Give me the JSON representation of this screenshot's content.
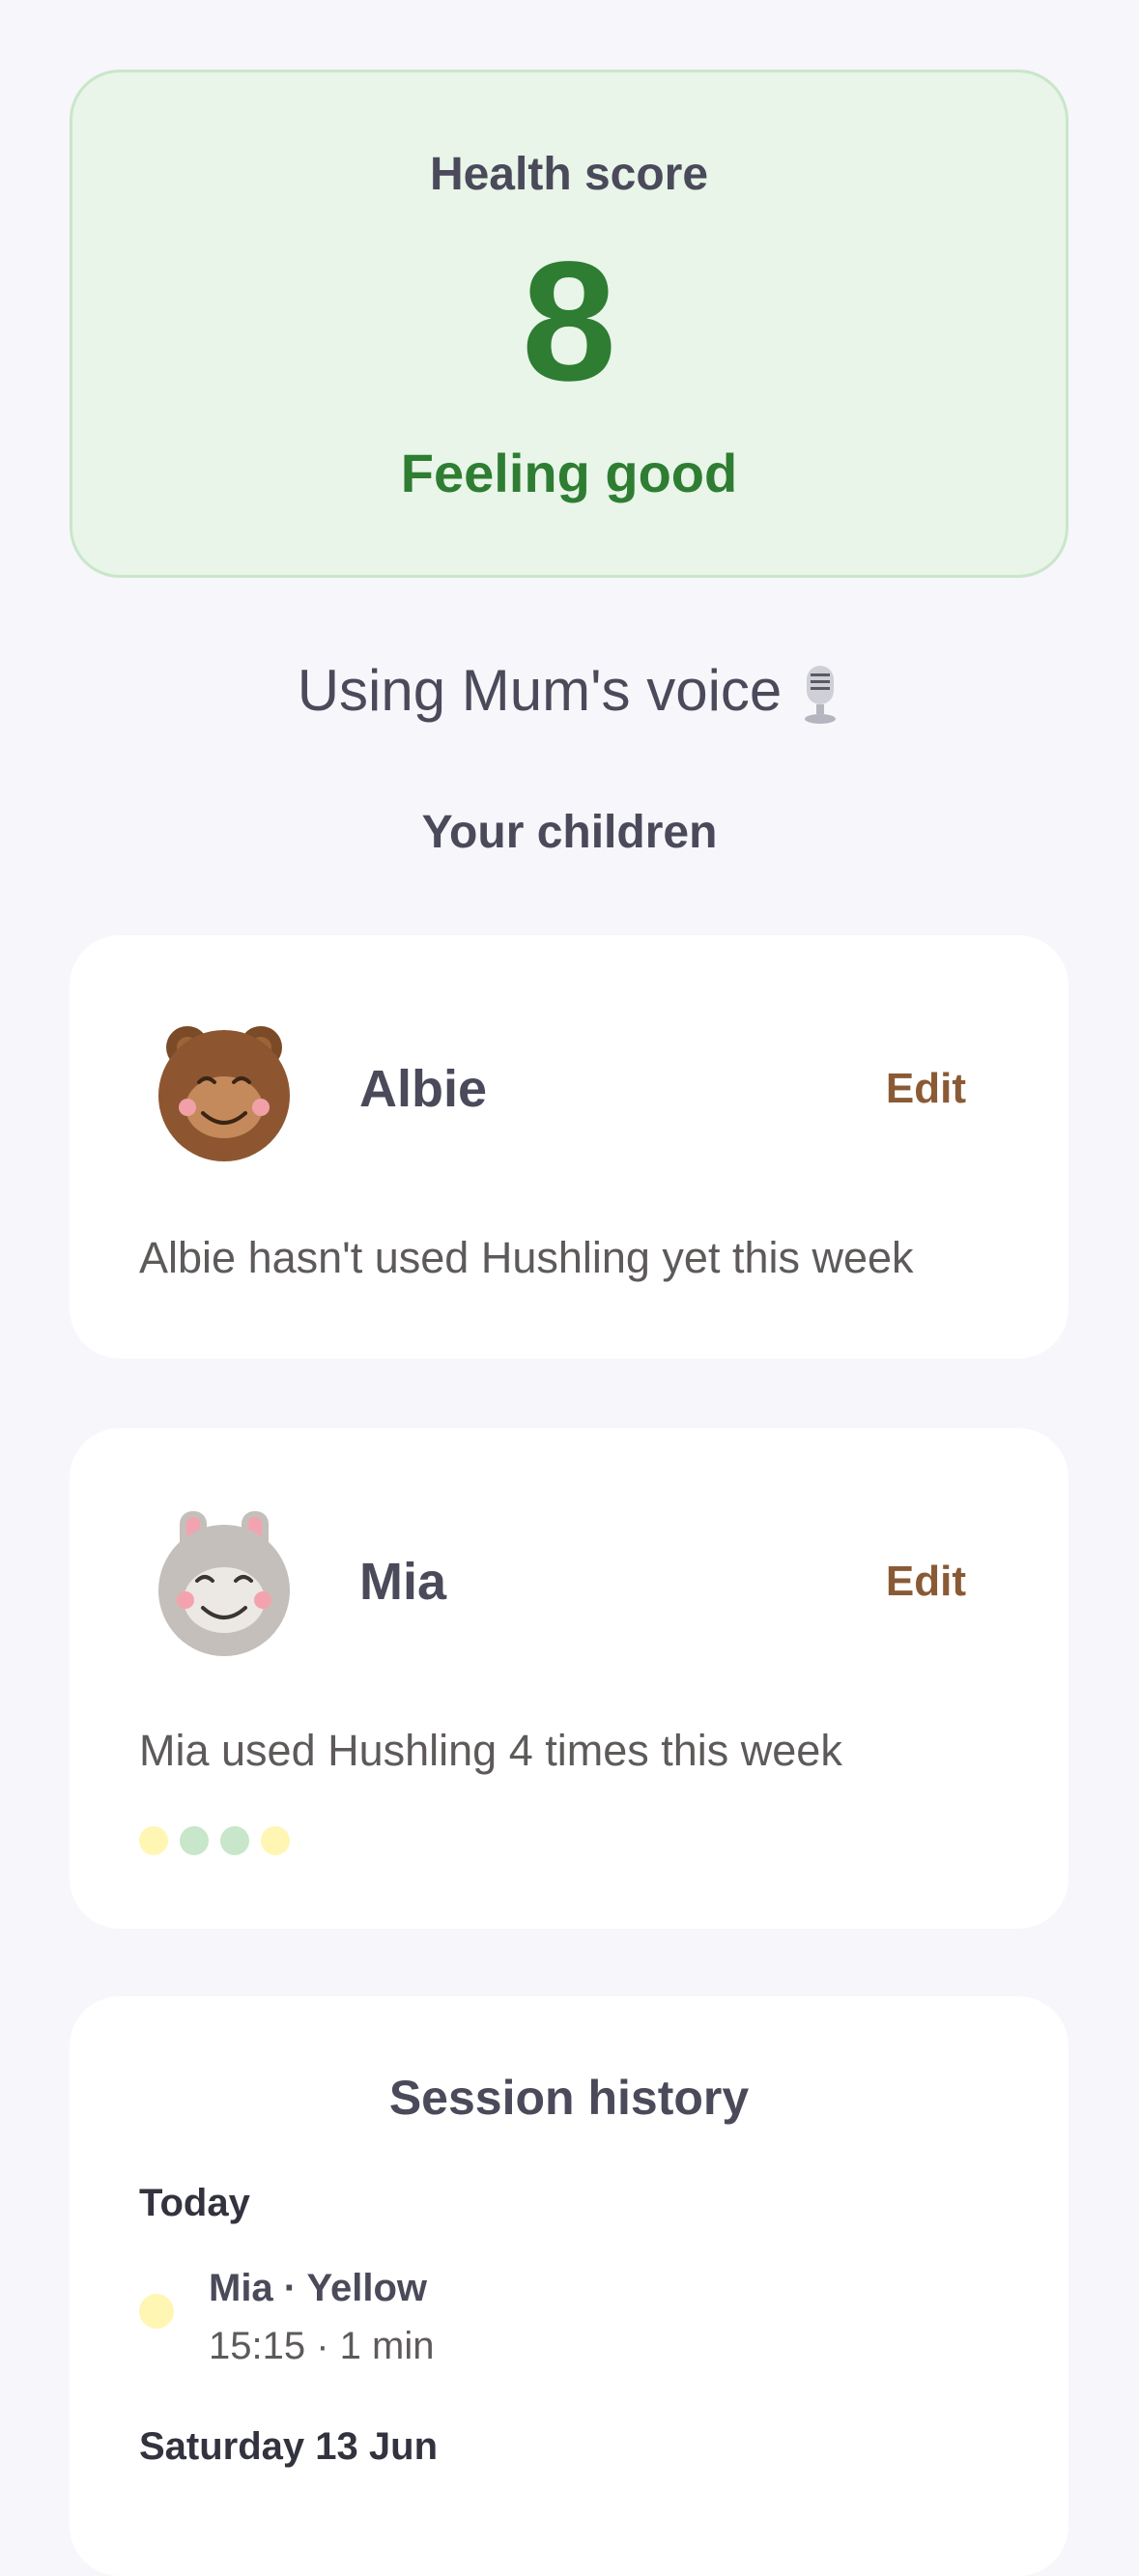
{
  "health": {
    "label": "Health score",
    "value": "8",
    "status": "Feeling good",
    "accent_color": "#2e7d32",
    "background_color": "#e8f5e8"
  },
  "voice": {
    "text": "Using Mum's voice",
    "icon": "microphone-icon"
  },
  "children_section": {
    "title": "Your children"
  },
  "children": [
    {
      "name": "Albie",
      "avatar": "bear-avatar-icon",
      "edit_label": "Edit",
      "summary": "Albie hasn't used Hushling yet this week"
    },
    {
      "name": "Mia",
      "avatar": "bunny-avatar-icon",
      "edit_label": "Edit",
      "summary": "Mia used Hushling 4 times this week",
      "week_sessions": [
        {
          "color": "#fff6b3"
        },
        {
          "color": "#c8e6c9"
        },
        {
          "color": "#c8e6c9"
        },
        {
          "color": "#fff6b3"
        }
      ]
    }
  ],
  "history": {
    "title": "Session history",
    "groups": [
      {
        "day": "Today",
        "sessions": [
          {
            "title": "Mia · Yellow",
            "meta": "15:15 · 1 min",
            "color": "#fff6b3"
          }
        ]
      },
      {
        "day": "Saturday 13 Jun",
        "sessions": []
      }
    ]
  }
}
